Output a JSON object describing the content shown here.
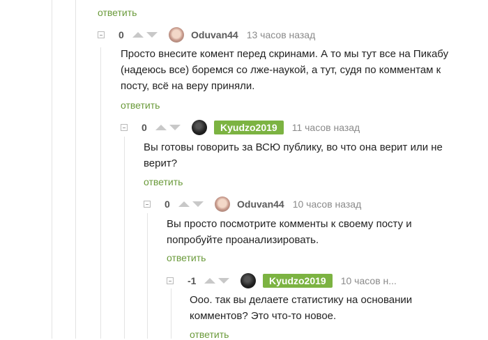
{
  "reply_label": "ответить",
  "comments": [
    {
      "rating": "0",
      "author": "Oduvan44",
      "time": "13 часов назад",
      "text_lines": [
        "Просто внесите комент перед скринами. А то мы тут все на Пикабу",
        "(надеюсь все) боремся со лже-наукой, а тут, судя по комментам к",
        "посту, всё на веру приняли."
      ]
    },
    {
      "rating": "0",
      "author": "Kyudzo2019",
      "time": "11 часов назад",
      "text_lines": [
        "Вы готовы говорить за ВСЮ публику, во что она верит или не",
        "верит?"
      ]
    },
    {
      "rating": "0",
      "author": "Oduvan44",
      "time": "10 часов назад",
      "text_lines": [
        "Вы просто посмотрите комменты к своему посту и",
        "попробуйте проанализировать."
      ]
    },
    {
      "rating": "-1",
      "author": "Kyudzo2019",
      "time": "10 часов н...",
      "text_lines": [
        "Ооо. так вы делаете статистику на основании",
        "комментов? Это что-то новое."
      ]
    }
  ]
}
